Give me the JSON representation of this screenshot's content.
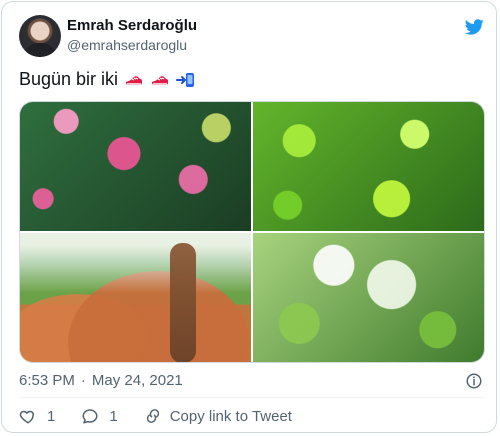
{
  "tweet": {
    "author": {
      "name": "Emrah Serdaroğlu",
      "handle": "@emrahserdaroglu"
    },
    "text": "Bugün bir iki",
    "emojis": [
      "running-shoe-icon",
      "running-shoe-icon",
      "phone-arrow-icon"
    ],
    "timestamp": {
      "time": "6:53 PM",
      "separator": "·",
      "date": "May 24, 2021"
    },
    "actions": {
      "likes": "1",
      "replies": "1",
      "copy_link_label": "Copy link to Tweet"
    }
  },
  "colors": {
    "text": "#0f1419",
    "secondary": "#536471",
    "border": "#cfd9de",
    "twitter_blue": "#1d9bf0"
  }
}
